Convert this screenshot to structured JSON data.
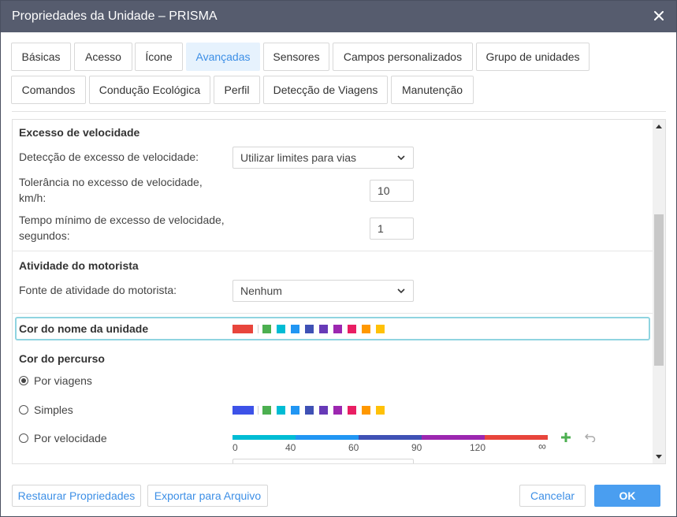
{
  "window": {
    "title": "Propriedades da Unidade – PRISMA"
  },
  "tabs": [
    {
      "label": "Básicas"
    },
    {
      "label": "Acesso"
    },
    {
      "label": "Ícone"
    },
    {
      "label": "Avançadas"
    },
    {
      "label": "Sensores"
    },
    {
      "label": "Campos personalizados"
    },
    {
      "label": "Grupo de unidades"
    },
    {
      "label": "Comandos"
    },
    {
      "label": "Condução Ecológica"
    },
    {
      "label": "Perfil"
    },
    {
      "label": "Detecção de Viagens"
    },
    {
      "label": "Manutenção"
    }
  ],
  "active_tab": "Avançadas",
  "speeding": {
    "title": "Excesso de velocidade",
    "detection_label": "Detecção de excesso de velocidade:",
    "detection_value": "Utilizar limites para vias",
    "tolerance_label_1": "Tolerância no excesso de velocidade,",
    "tolerance_label_2": "km/h:",
    "tolerance_value": "10",
    "min_time_label_1": "Tempo mínimo de excesso de velocidade,",
    "min_time_label_2": "segundos:",
    "min_time_value": "1"
  },
  "driver": {
    "title": "Atividade do motorista",
    "source_label": "Fonte de atividade do motorista:",
    "source_value": "Nenhum"
  },
  "unit_name_color": {
    "label": "Cor do nome da unidade",
    "selected": "#e8453c",
    "palette": [
      "#4caf50",
      "#00bcd4",
      "#2196f3",
      "#3f51b5",
      "#673ab7",
      "#9c27b0",
      "#e91e63",
      "#ff9800",
      "#ffc107"
    ]
  },
  "track_color": {
    "title": "Cor do percurso",
    "options": [
      {
        "label": "Por viagens",
        "checked": true
      },
      {
        "label": "Simples",
        "checked": false
      },
      {
        "label": "Por velocidade",
        "checked": false
      }
    ],
    "simple_selected": "#3d52e8",
    "simple_palette": [
      "#4caf50",
      "#00bcd4",
      "#2196f3",
      "#3f51b5",
      "#673ab7",
      "#9c27b0",
      "#e91e63",
      "#ff9800",
      "#ffc107"
    ],
    "speed_gradient": [
      "#00bcd4",
      "#2196f3",
      "#3f51b5",
      "#9c27b0",
      "#e8453c"
    ],
    "speed_ticks": [
      "0",
      "40",
      "60",
      "90",
      "120",
      "∞"
    ]
  },
  "footer": {
    "restore_label": "Restaurar Propriedades",
    "export_label": "Exportar para Arquivo",
    "cancel_label": "Cancelar",
    "ok_label": "OK"
  },
  "icons": {
    "close": "close-icon",
    "chevron": "chevron-down-icon",
    "add": "plus-icon",
    "undo": "undo-icon"
  },
  "colors": {
    "accent": "#3d8fe6",
    "titlebar": "#565c6e",
    "ok_button": "#4a9ef0",
    "add_icon": "#4caf50"
  }
}
